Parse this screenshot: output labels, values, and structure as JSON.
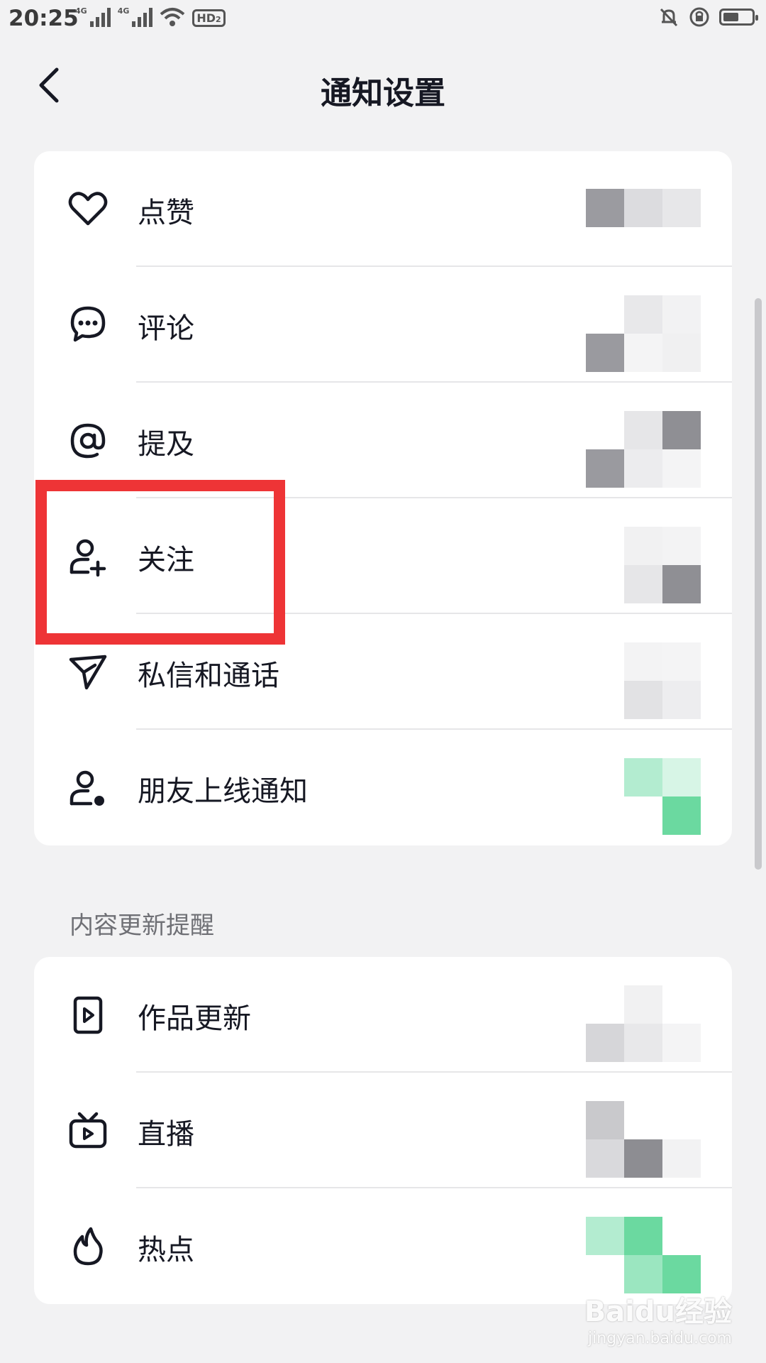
{
  "status_bar": {
    "time": "20:25",
    "network_1": "4G",
    "network_2": "4G",
    "hd_label": "HD",
    "hd_sub": "2",
    "icons": [
      "signal-icon",
      "wifi-icon",
      "hd-icon",
      "mute-icon",
      "rotation-lock-icon",
      "battery-icon"
    ],
    "battery_level": 0.55
  },
  "header": {
    "title": "通知设置",
    "back_icon": "chevron-left-icon"
  },
  "interaction_section": {
    "items": [
      {
        "label": "点赞",
        "icon": "heart-icon"
      },
      {
        "label": "评论",
        "icon": "comment-icon"
      },
      {
        "label": "提及",
        "icon": "at-icon"
      },
      {
        "label": "关注",
        "icon": "user-plus-icon",
        "highlighted": true
      },
      {
        "label": "私信和通话",
        "icon": "send-icon"
      },
      {
        "label": "朋友上线通知",
        "icon": "user-online-icon"
      }
    ]
  },
  "content_section": {
    "title": "内容更新提醒",
    "items": [
      {
        "label": "作品更新",
        "icon": "video-file-icon"
      },
      {
        "label": "直播",
        "icon": "tv-icon"
      },
      {
        "label": "热点",
        "icon": "flame-icon"
      }
    ]
  },
  "colors": {
    "highlight": "#ee3436",
    "accent_green": "#6bd9a0",
    "background": "#f2f2f3",
    "text": "#161823"
  },
  "watermark": {
    "brand": "Baidu经验",
    "url": "jingyan.baidu.com"
  }
}
